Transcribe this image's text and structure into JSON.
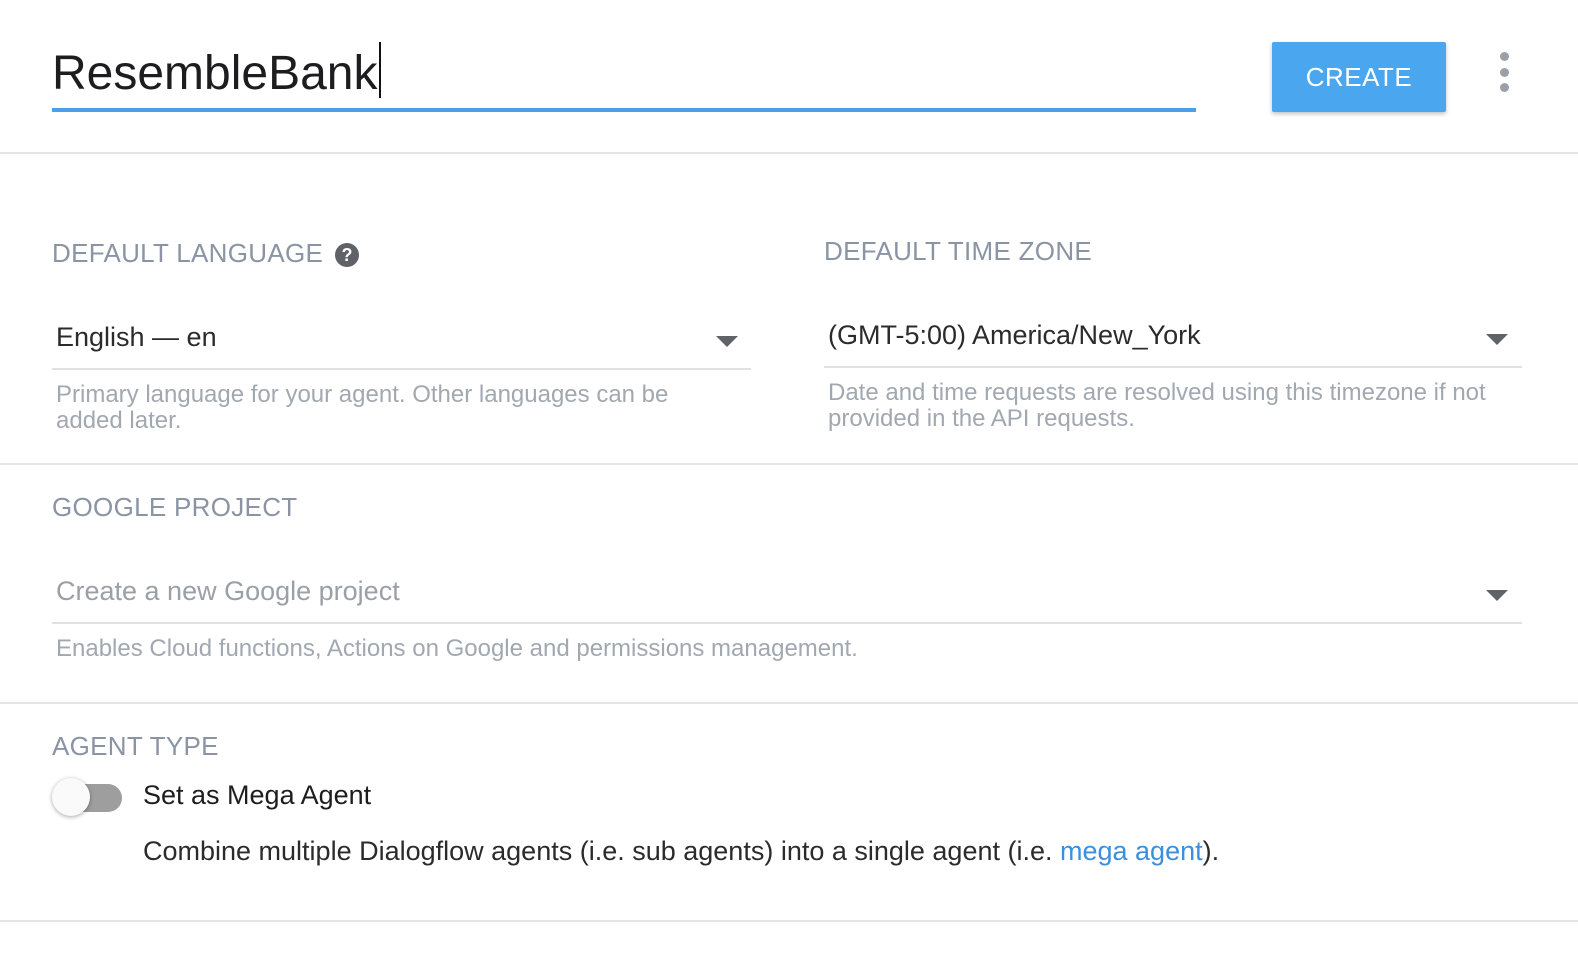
{
  "header": {
    "agent_name": "ResembleBank",
    "create_label": "CREATE",
    "more_icon": "more-vert-icon"
  },
  "language": {
    "label": "DEFAULT LANGUAGE",
    "help_icon": "help-icon",
    "value": "English — en",
    "hint": "Primary language for your agent. Other languages can be added later."
  },
  "timezone": {
    "label": "DEFAULT TIME ZONE",
    "value": "(GMT-5:00) America/New_York",
    "hint": "Date and time requests are resolved using this timezone if not provided in the API requests."
  },
  "google_project": {
    "label": "GOOGLE PROJECT",
    "placeholder": "Create a new Google project",
    "hint": "Enables Cloud functions, Actions on Google and permissions management."
  },
  "agent_type": {
    "label": "AGENT TYPE",
    "toggle_label": "Set as Mega Agent",
    "toggle_on": false,
    "desc_prefix": "Combine multiple Dialogflow agents (i.e. sub agents) into a single agent (i.e. ",
    "desc_link": "mega agent",
    "desc_suffix": ")."
  },
  "colors": {
    "accent": "#4aa6ee",
    "underline_active": "#4a9fe8",
    "link": "#3b8fdc",
    "label_gray": "#8a94a4"
  }
}
